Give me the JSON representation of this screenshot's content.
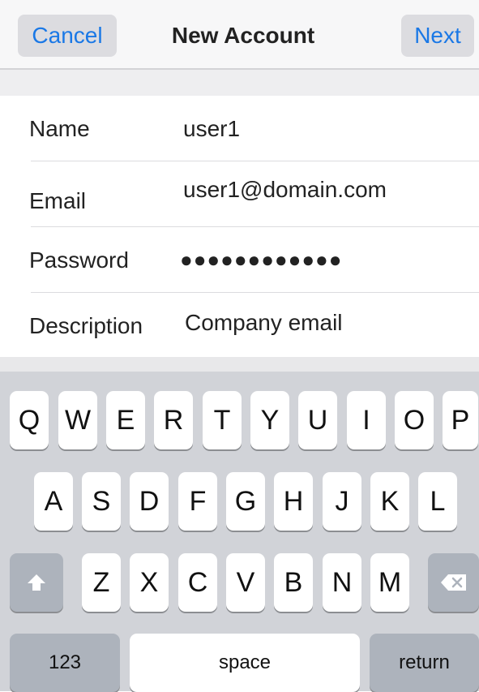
{
  "nav": {
    "cancel_label": "Cancel",
    "title": "New Account",
    "next_label": "Next"
  },
  "form": {
    "fields": [
      {
        "label": "Name",
        "value": "user1"
      },
      {
        "label": "Email",
        "value": "user1@domain.com"
      },
      {
        "label": "Password",
        "value": "●●●●●●●●●●●●"
      },
      {
        "label": "Description",
        "value": "Company email"
      }
    ]
  },
  "keyboard": {
    "row1": [
      "Q",
      "W",
      "E",
      "R",
      "T",
      "Y",
      "U",
      "I",
      "O",
      "P"
    ],
    "row2": [
      "A",
      "S",
      "D",
      "F",
      "G",
      "H",
      "J",
      "K",
      "L"
    ],
    "row3": [
      "Z",
      "X",
      "C",
      "V",
      "B",
      "N",
      "M"
    ],
    "numbers_label": "123",
    "space_label": "space",
    "return_label": "return",
    "shift_icon": "shift-arrow-icon",
    "delete_icon": "backspace-icon"
  }
}
